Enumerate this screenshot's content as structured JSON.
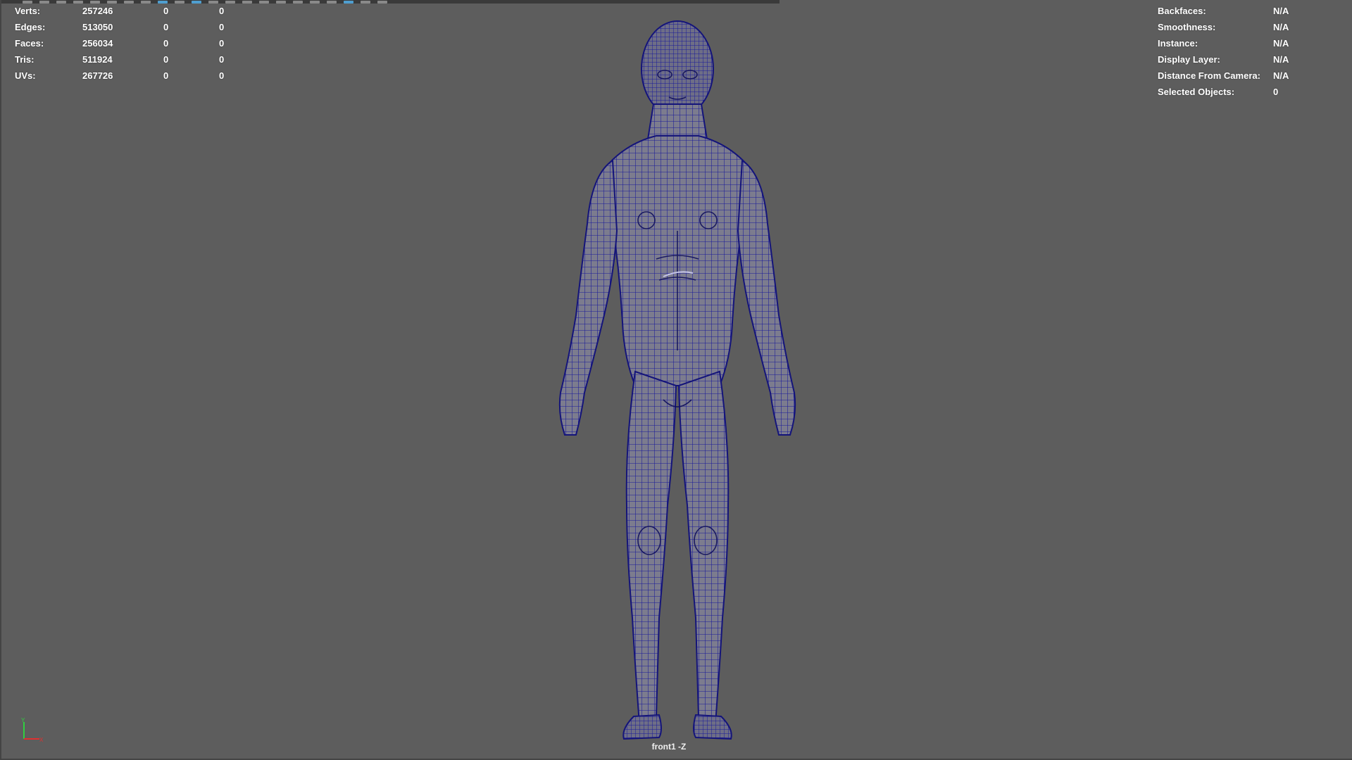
{
  "toolbar": {
    "button_count": 22
  },
  "hud_left": {
    "rows": [
      {
        "label": "Verts:",
        "total": "257246",
        "selected": "0",
        "components": "0"
      },
      {
        "label": "Edges:",
        "total": "513050",
        "selected": "0",
        "components": "0"
      },
      {
        "label": "Faces:",
        "total": "256034",
        "selected": "0",
        "components": "0"
      },
      {
        "label": "Tris:",
        "total": "511924",
        "selected": "0",
        "components": "0"
      },
      {
        "label": "UVs:",
        "total": "267726",
        "selected": "0",
        "components": "0"
      }
    ]
  },
  "hud_right": {
    "rows": [
      {
        "label": "Backfaces:",
        "value": "N/A"
      },
      {
        "label": "Smoothness:",
        "value": "N/A"
      },
      {
        "label": "Instance:",
        "value": "N/A"
      },
      {
        "label": "Display Layer:",
        "value": "N/A"
      },
      {
        "label": "Distance From Camera:",
        "value": "N/A"
      },
      {
        "label": "Selected Objects:",
        "value": "0"
      }
    ]
  },
  "camera_label": "front1 -Z",
  "axis": {
    "y_label": "Y",
    "x_label": "X"
  },
  "colors": {
    "background": "#5d5d5d",
    "wireframe": "#1a1a9a",
    "mesh_fill": "#7a7a8c",
    "axis_x": "#e03030",
    "axis_y": "#30d040"
  }
}
